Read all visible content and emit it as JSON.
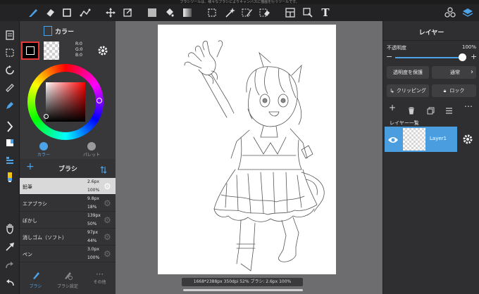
{
  "notice": "ブラシツールは、様々なブラシによりキャンバスに描画を行うツールです。",
  "colors": {
    "accent": "#2f8fdc",
    "panel": "#38383a",
    "layer_selected": "#4a9ee0",
    "paper": "#ffffff"
  },
  "top_toolbar": {
    "icons": [
      "brush-icon",
      "eraser-icon",
      "square-icon",
      "pen-tool-icon",
      "move-icon",
      "transform-icon",
      "fill-color-icon",
      "bucket-icon",
      "gradation-icon",
      "select-rect-icon",
      "magic-wand-icon",
      "select-pen-icon",
      "select-eraser-icon",
      "frame-icon",
      "snap-icon",
      "text-icon",
      "materials-icon",
      "layers-icon"
    ]
  },
  "left_tools": [
    "file-icon",
    "select-icon",
    "rotate-icon",
    "ruler-icon",
    "pen-nib-icon",
    "collapse-icon",
    "color-chip-icon",
    "layer-settings-icon",
    "brush-color-icon",
    "hand-icon",
    "eyedropper-icon",
    "redo-icon",
    "undo-icon"
  ],
  "color_panel": {
    "title": "カラー",
    "rgb": {
      "r": "R:0",
      "g": "G:0",
      "b": "B:0"
    },
    "tabs": [
      {
        "label": "カラー",
        "active": true
      },
      {
        "label": "パレット",
        "active": false
      }
    ]
  },
  "brush_panel": {
    "title": "ブラシ",
    "add_label": "+",
    "items": [
      {
        "name": "鉛筆",
        "size": "2.6px",
        "opacity": "100%",
        "selected": true
      },
      {
        "name": "エアブラシ",
        "size": "9.8px",
        "opacity": "18%",
        "selected": false
      },
      {
        "name": "ぼかし",
        "size": "139px",
        "opacity": "50%",
        "selected": false
      },
      {
        "name": "消しゴム（ソフト）",
        "size": "97px",
        "opacity": "44%",
        "selected": false
      },
      {
        "name": "ペン",
        "size": "3.0px",
        "opacity": "100%",
        "selected": false
      }
    ],
    "bottom_tabs": [
      {
        "label": "ブラシ",
        "active": true
      },
      {
        "label": "ブラシ設定",
        "active": false
      },
      {
        "label": "その他",
        "active": false
      }
    ]
  },
  "status": "1668*2388px 350dpi 52% ブラシ: 2.6px 100%",
  "layer_panel": {
    "title": "レイヤー",
    "opacity_label": "不透明度",
    "opacity_value": "100%",
    "opacity_level": 1.0,
    "protect_label": "透明度を保護",
    "blend_label": "通常",
    "clipping_label": "クリッピング",
    "lock_label": "ロック",
    "list_label": "レイヤー一覧",
    "layers": [
      {
        "name": "Layer1",
        "selected": true
      }
    ]
  }
}
